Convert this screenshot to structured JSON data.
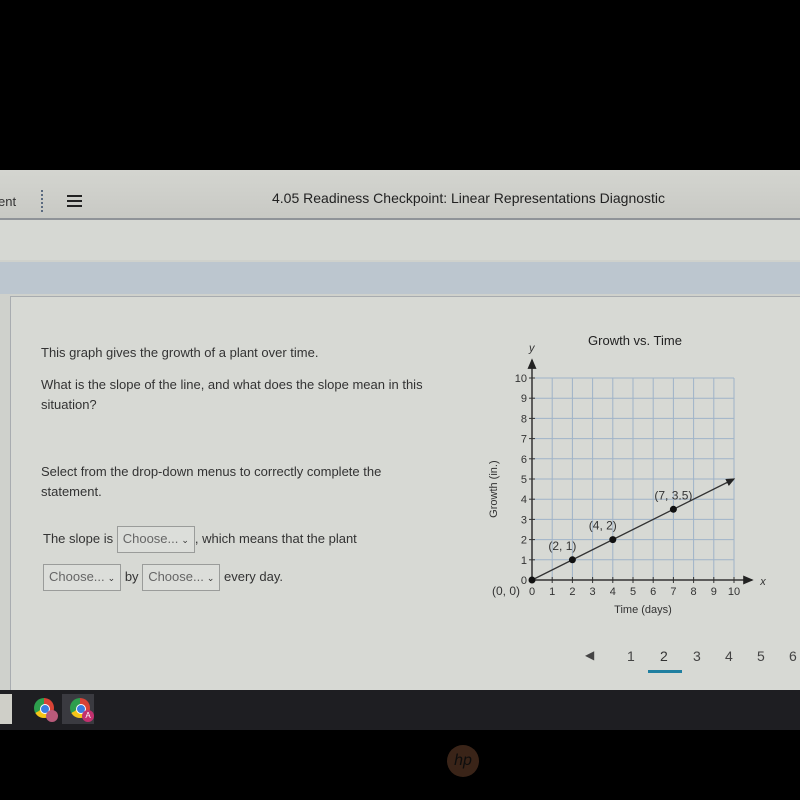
{
  "header": {
    "breadcrumb_fragment": "ent",
    "title": "4.05 Readiness Checkpoint: Linear Representations Diagnostic",
    "icons": [
      "kebab-menu-icon",
      "hamburger-menu-icon"
    ]
  },
  "question": {
    "intro": "This graph gives the growth of a plant over time.",
    "prompt": "What is the slope of the line, and what does the slope mean in this situation?",
    "instruction": "Select from the drop-down menus to correctly complete the statement.",
    "statement": {
      "part1": "The slope is",
      "part2": ", which means that the plant",
      "part3": "by",
      "part4": "every day."
    },
    "dropdowns": [
      {
        "selected": "Choose..."
      },
      {
        "selected": "Choose..."
      },
      {
        "selected": "Choose..."
      }
    ]
  },
  "pagination": {
    "prev_icon": "◀",
    "pages": [
      "1",
      "2",
      "3",
      "4",
      "5",
      "6"
    ],
    "active_page": "2",
    "active_color": "#1f7fa0"
  },
  "taskbar": {
    "apps": [
      {
        "name": "chrome",
        "badge": ""
      },
      {
        "name": "chrome-profile",
        "badge": "A"
      }
    ]
  },
  "chart_data": {
    "type": "line",
    "title": "Growth vs. Time",
    "xlabel": "Time (days)",
    "ylabel": "Growth (in.)",
    "x_axis_symbol": "x",
    "y_axis_symbol": "y",
    "xlim": [
      0,
      10
    ],
    "ylim": [
      0,
      10
    ],
    "xticks": [
      "0",
      "1",
      "2",
      "3",
      "4",
      "5",
      "6",
      "7",
      "8",
      "9",
      "10"
    ],
    "yticks": [
      "0",
      "1",
      "2",
      "3",
      "4",
      "5",
      "6",
      "7",
      "8",
      "9",
      "10"
    ],
    "grid": true,
    "line": {
      "from": [
        0,
        0
      ],
      "to": [
        10,
        5
      ],
      "arrow_end": true
    },
    "points": [
      {
        "x": 0,
        "y": 0,
        "label": "(0, 0)"
      },
      {
        "x": 2,
        "y": 1,
        "label": "(2, 1)"
      },
      {
        "x": 4,
        "y": 2,
        "label": "(4, 2)"
      },
      {
        "x": 7,
        "y": 3.5,
        "label": "(7, 3.5)"
      }
    ]
  }
}
